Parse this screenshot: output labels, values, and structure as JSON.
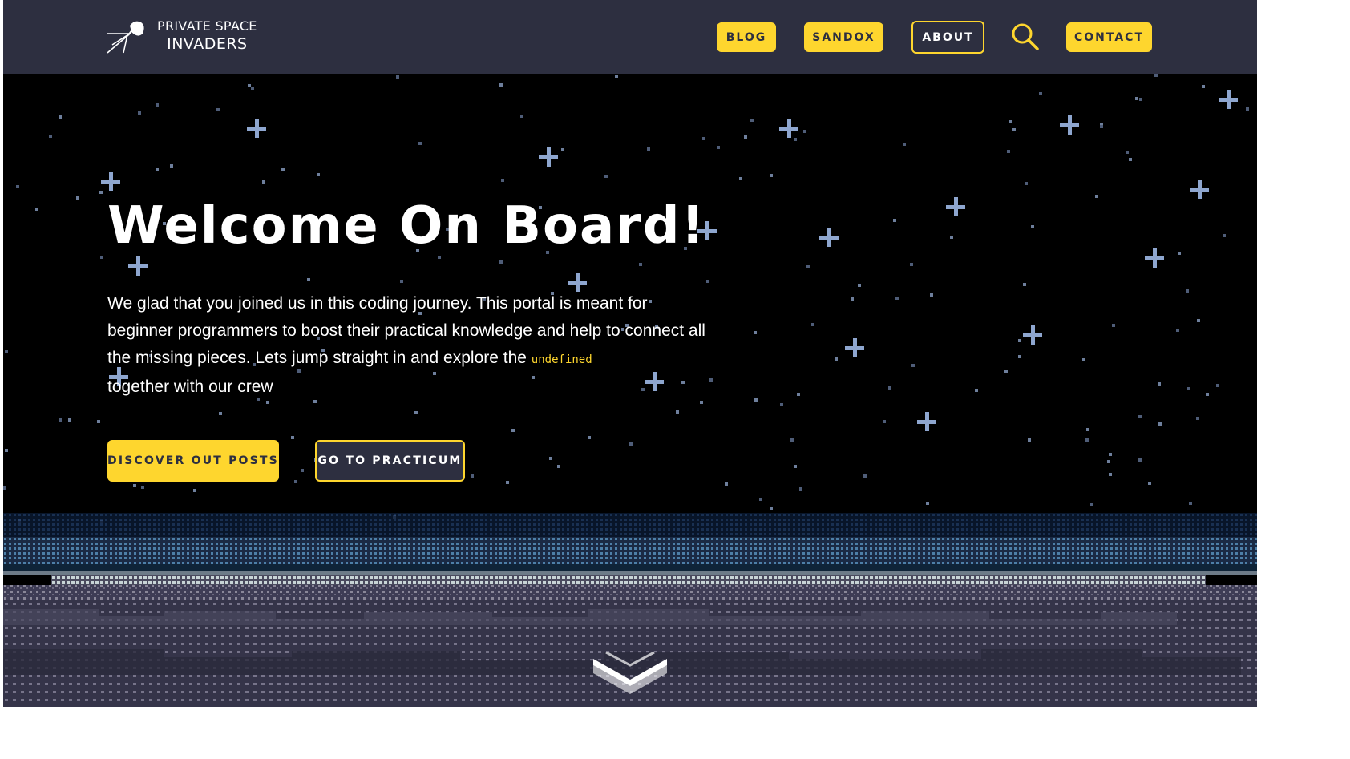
{
  "brand": {
    "line1": "PRIVATE SPACE",
    "line2": "INVADERS",
    "logo_icon": "satellite-icon"
  },
  "nav": {
    "blog": "BLOG",
    "sandbox": "SANDOX",
    "about": "ABOUT",
    "search_icon": "search-icon",
    "contact": "CONTACT"
  },
  "hero": {
    "title": "Welcome On Board!",
    "text_part1": "We glad that you joined us in this coding journey. This portal is meant for beginner programmers to boost their practical knowledge and help to connect all the missing pieces. Lets jump straight in and explore the ",
    "code_word": "undefined",
    "text_part2": "together with our crew",
    "primary_cta": "DISCOVER OUT POSTS",
    "secondary_cta": "GO TO PRACTICUM",
    "scroll_icon": "chevron-down-icon"
  },
  "colors": {
    "accent": "#fed62e",
    "navbar": "#2d2f40",
    "background": "#000000",
    "star": "#8ea6cf"
  }
}
